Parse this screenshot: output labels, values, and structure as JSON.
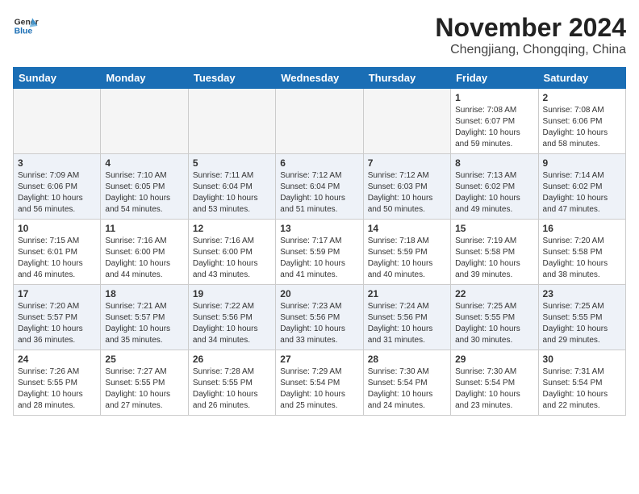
{
  "header": {
    "logo_line1": "General",
    "logo_line2": "Blue",
    "title": "November 2024",
    "subtitle": "Chengjiang, Chongqing, China"
  },
  "weekdays": [
    "Sunday",
    "Monday",
    "Tuesday",
    "Wednesday",
    "Thursday",
    "Friday",
    "Saturday"
  ],
  "weeks": [
    {
      "alt": false,
      "days": [
        {
          "num": "",
          "info": ""
        },
        {
          "num": "",
          "info": ""
        },
        {
          "num": "",
          "info": ""
        },
        {
          "num": "",
          "info": ""
        },
        {
          "num": "",
          "info": ""
        },
        {
          "num": "1",
          "info": "Sunrise: 7:08 AM\nSunset: 6:07 PM\nDaylight: 10 hours\nand 59 minutes."
        },
        {
          "num": "2",
          "info": "Sunrise: 7:08 AM\nSunset: 6:06 PM\nDaylight: 10 hours\nand 58 minutes."
        }
      ]
    },
    {
      "alt": true,
      "days": [
        {
          "num": "3",
          "info": "Sunrise: 7:09 AM\nSunset: 6:06 PM\nDaylight: 10 hours\nand 56 minutes."
        },
        {
          "num": "4",
          "info": "Sunrise: 7:10 AM\nSunset: 6:05 PM\nDaylight: 10 hours\nand 54 minutes."
        },
        {
          "num": "5",
          "info": "Sunrise: 7:11 AM\nSunset: 6:04 PM\nDaylight: 10 hours\nand 53 minutes."
        },
        {
          "num": "6",
          "info": "Sunrise: 7:12 AM\nSunset: 6:04 PM\nDaylight: 10 hours\nand 51 minutes."
        },
        {
          "num": "7",
          "info": "Sunrise: 7:12 AM\nSunset: 6:03 PM\nDaylight: 10 hours\nand 50 minutes."
        },
        {
          "num": "8",
          "info": "Sunrise: 7:13 AM\nSunset: 6:02 PM\nDaylight: 10 hours\nand 49 minutes."
        },
        {
          "num": "9",
          "info": "Sunrise: 7:14 AM\nSunset: 6:02 PM\nDaylight: 10 hours\nand 47 minutes."
        }
      ]
    },
    {
      "alt": false,
      "days": [
        {
          "num": "10",
          "info": "Sunrise: 7:15 AM\nSunset: 6:01 PM\nDaylight: 10 hours\nand 46 minutes."
        },
        {
          "num": "11",
          "info": "Sunrise: 7:16 AM\nSunset: 6:00 PM\nDaylight: 10 hours\nand 44 minutes."
        },
        {
          "num": "12",
          "info": "Sunrise: 7:16 AM\nSunset: 6:00 PM\nDaylight: 10 hours\nand 43 minutes."
        },
        {
          "num": "13",
          "info": "Sunrise: 7:17 AM\nSunset: 5:59 PM\nDaylight: 10 hours\nand 41 minutes."
        },
        {
          "num": "14",
          "info": "Sunrise: 7:18 AM\nSunset: 5:59 PM\nDaylight: 10 hours\nand 40 minutes."
        },
        {
          "num": "15",
          "info": "Sunrise: 7:19 AM\nSunset: 5:58 PM\nDaylight: 10 hours\nand 39 minutes."
        },
        {
          "num": "16",
          "info": "Sunrise: 7:20 AM\nSunset: 5:58 PM\nDaylight: 10 hours\nand 38 minutes."
        }
      ]
    },
    {
      "alt": true,
      "days": [
        {
          "num": "17",
          "info": "Sunrise: 7:20 AM\nSunset: 5:57 PM\nDaylight: 10 hours\nand 36 minutes."
        },
        {
          "num": "18",
          "info": "Sunrise: 7:21 AM\nSunset: 5:57 PM\nDaylight: 10 hours\nand 35 minutes."
        },
        {
          "num": "19",
          "info": "Sunrise: 7:22 AM\nSunset: 5:56 PM\nDaylight: 10 hours\nand 34 minutes."
        },
        {
          "num": "20",
          "info": "Sunrise: 7:23 AM\nSunset: 5:56 PM\nDaylight: 10 hours\nand 33 minutes."
        },
        {
          "num": "21",
          "info": "Sunrise: 7:24 AM\nSunset: 5:56 PM\nDaylight: 10 hours\nand 31 minutes."
        },
        {
          "num": "22",
          "info": "Sunrise: 7:25 AM\nSunset: 5:55 PM\nDaylight: 10 hours\nand 30 minutes."
        },
        {
          "num": "23",
          "info": "Sunrise: 7:25 AM\nSunset: 5:55 PM\nDaylight: 10 hours\nand 29 minutes."
        }
      ]
    },
    {
      "alt": false,
      "days": [
        {
          "num": "24",
          "info": "Sunrise: 7:26 AM\nSunset: 5:55 PM\nDaylight: 10 hours\nand 28 minutes."
        },
        {
          "num": "25",
          "info": "Sunrise: 7:27 AM\nSunset: 5:55 PM\nDaylight: 10 hours\nand 27 minutes."
        },
        {
          "num": "26",
          "info": "Sunrise: 7:28 AM\nSunset: 5:55 PM\nDaylight: 10 hours\nand 26 minutes."
        },
        {
          "num": "27",
          "info": "Sunrise: 7:29 AM\nSunset: 5:54 PM\nDaylight: 10 hours\nand 25 minutes."
        },
        {
          "num": "28",
          "info": "Sunrise: 7:30 AM\nSunset: 5:54 PM\nDaylight: 10 hours\nand 24 minutes."
        },
        {
          "num": "29",
          "info": "Sunrise: 7:30 AM\nSunset: 5:54 PM\nDaylight: 10 hours\nand 23 minutes."
        },
        {
          "num": "30",
          "info": "Sunrise: 7:31 AM\nSunset: 5:54 PM\nDaylight: 10 hours\nand 22 minutes."
        }
      ]
    }
  ]
}
